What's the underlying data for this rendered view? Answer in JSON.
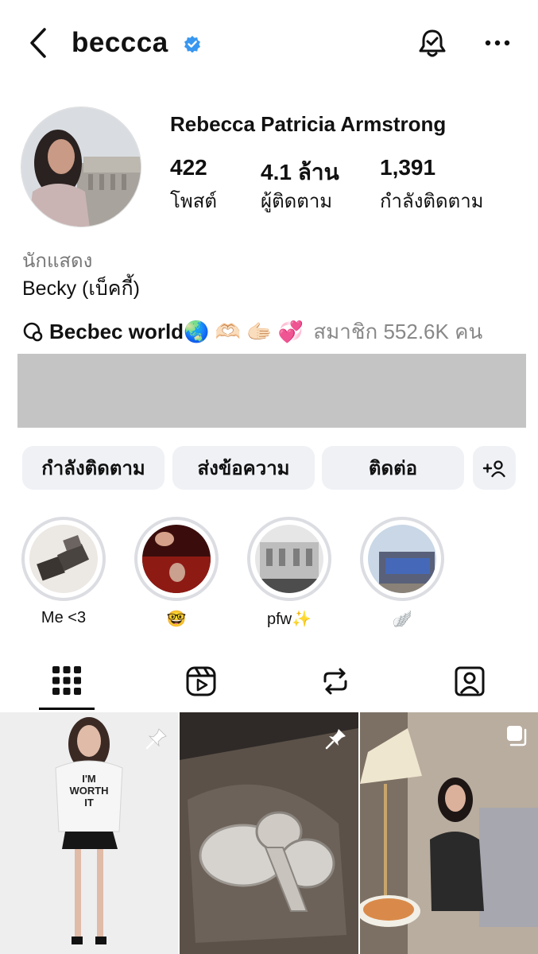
{
  "header": {
    "username": "beccca",
    "icons": [
      "chevron-left-icon",
      "verified-badge-icon",
      "notification-bell-icon",
      "more-icon"
    ]
  },
  "profile": {
    "full_name": "Rebecca Patricia Armstrong",
    "stats": [
      {
        "value": "422",
        "label": "โพสต์"
      },
      {
        "value": "4.1 ล้าน",
        "label": "ผู้ติดตาม"
      },
      {
        "value": "1,391",
        "label": "กำลังติดตาม"
      }
    ],
    "category": "นักแสดง",
    "bio": "Becky (เบ็คกี้)",
    "channel": {
      "name": "Becbec world🌏 🫶🏻 🫱🏻 💞",
      "members": "สมาชิก 552.6K คน"
    }
  },
  "actions": {
    "following": "กำลังติดตาม",
    "message": "ส่งข้อความ",
    "contact": "ติดต่อ",
    "add_person_icon": "add-person-icon"
  },
  "highlights": [
    {
      "label": "Me <3"
    },
    {
      "label": "🤓"
    },
    {
      "label": "pfw✨"
    },
    {
      "label": "🪽"
    }
  ],
  "tabs": [
    "grid-icon",
    "reels-icon",
    "reposts-icon",
    "tagged-icon"
  ],
  "colors": {
    "accent": "#3897f0",
    "button_bg": "#eff1f5",
    "banner": "#c4c4c4"
  }
}
